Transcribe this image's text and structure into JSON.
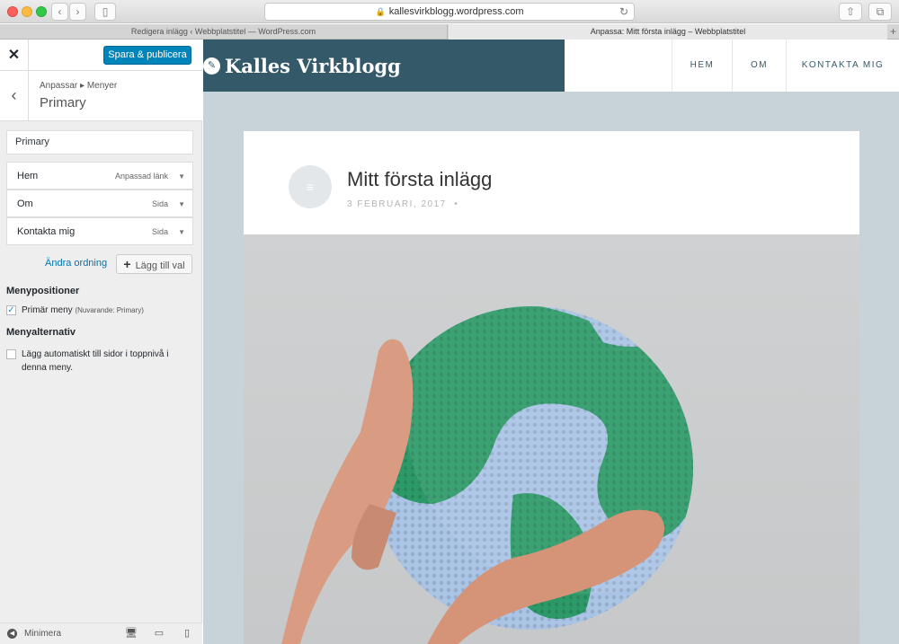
{
  "browser": {
    "url": "kallesvirkblogg.wordpress.com",
    "tabs": [
      {
        "title": "Redigera inlägg ‹ Webbplatstitel — WordPress.com"
      },
      {
        "title": "Anpassa: Mitt första inlägg – Webbplatstitel"
      }
    ],
    "icons": [
      "back-icon",
      "forward-icon",
      "sidebar-icon",
      "lock-icon",
      "reload-icon",
      "share-icon",
      "tabs-icon",
      "new-tab-icon"
    ]
  },
  "customizer": {
    "close_icon": "close-icon",
    "publish_label": "Spara & publicera",
    "breadcrumb": "Anpassar ▸ Menyer",
    "section_title": "Primary",
    "menu_name": "Primary",
    "menu_items": [
      {
        "title": "Hem",
        "type": "Anpassad länk"
      },
      {
        "title": "Om",
        "type": "Sida"
      },
      {
        "title": "Kontakta mig",
        "type": "Sida"
      }
    ],
    "reorder_label": "Ändra ordning",
    "add_items_label": "Lägg till val",
    "locations_heading": "Menypositioner",
    "location_label": "Primär meny",
    "location_current": "(Nuvarande: Primary)",
    "location_checked": true,
    "options_heading": "Menyalternativ",
    "auto_add_label": "Lägg automatiskt till sidor i toppnivå i denna meny.",
    "auto_add_checked": false,
    "collapse_label": "Minimera",
    "device_icons": [
      "desktop-icon",
      "tablet-icon",
      "mobile-icon"
    ]
  },
  "site": {
    "title": "Kalles Virkblogg",
    "nav": [
      "HEM",
      "OM",
      "KONTAKTA MIG"
    ],
    "post_title": "Mitt första inlägg",
    "post_date": "3 FEBRUARI, 2017",
    "post_date_sep": "•"
  },
  "colors": {
    "publish_button": "#0085ba",
    "brand_bar": "#345a6a",
    "preview_bg": "#c7d3d9",
    "link": "#0073aa"
  }
}
